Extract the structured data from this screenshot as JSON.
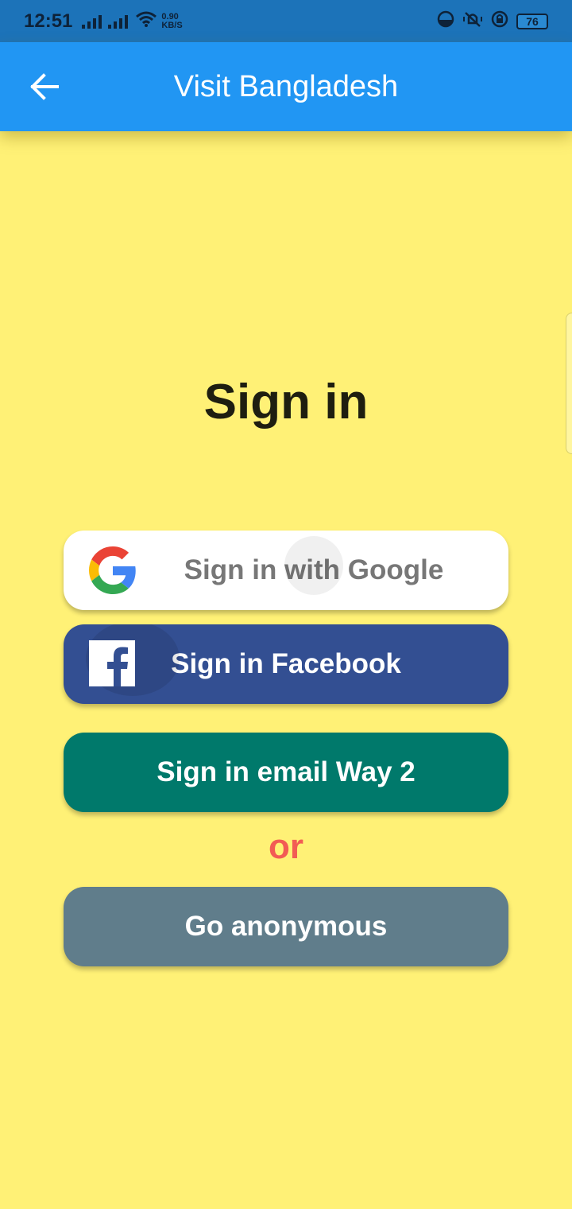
{
  "status_bar": {
    "time": "12:51",
    "net_speed_value": "0.90",
    "net_speed_unit": "KB/S",
    "battery": "76",
    "icons": [
      "signal-icon",
      "signal-icon",
      "wifi-icon",
      "data-saver-icon",
      "vibrate-icon",
      "rotation-lock-icon",
      "battery-icon"
    ]
  },
  "app_bar": {
    "title": "Visit Bangladesh",
    "back_icon": "arrow-left-icon"
  },
  "main": {
    "heading": "Sign in",
    "google_button": {
      "label": "Sign in with Google",
      "icon": "google-logo-icon"
    },
    "facebook_button": {
      "label": "Sign in Facebook",
      "icon": "facebook-logo-icon"
    },
    "email_button": {
      "label": "Sign in email Way 2"
    },
    "divider_text": "or",
    "anonymous_button": {
      "label": "Go anonymous"
    }
  },
  "colors": {
    "background": "#FFF176",
    "app_bar": "#2196F3",
    "status_bar": "#1C73B9",
    "google_button": "#FFFFFF",
    "facebook_button": "#334F92",
    "email_button": "#00796B",
    "anonymous_button": "#607D8B",
    "or_text": "#F25C54"
  }
}
